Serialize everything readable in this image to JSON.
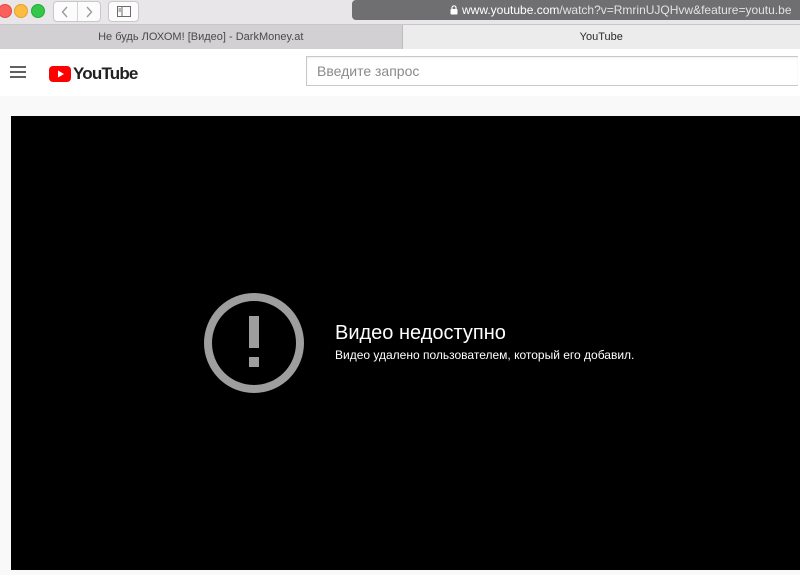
{
  "browser": {
    "url_host": "www.youtube.com",
    "url_rest": "/watch?v=RmrinUJQHvw&feature=youtu.be",
    "back_icon": "chevron-left-icon",
    "forward_icon": "chevron-right-icon",
    "sidebar_icon": "sidebar-icon",
    "lock_icon": "lock-icon"
  },
  "tabs": [
    {
      "label": "Не будь ЛОХОМ! [Видео] - DarkMoney.at",
      "active": false
    },
    {
      "label": "YouTube",
      "active": true
    }
  ],
  "youtube": {
    "logo_text": "YouTube",
    "search_placeholder": "Введите запрос",
    "brand_color": "#ff0000"
  },
  "player": {
    "error_title": "Видео недоступно",
    "error_message": "Видео удалено пользователем, который его добавил.",
    "icon": "exclamation-circle-icon"
  }
}
